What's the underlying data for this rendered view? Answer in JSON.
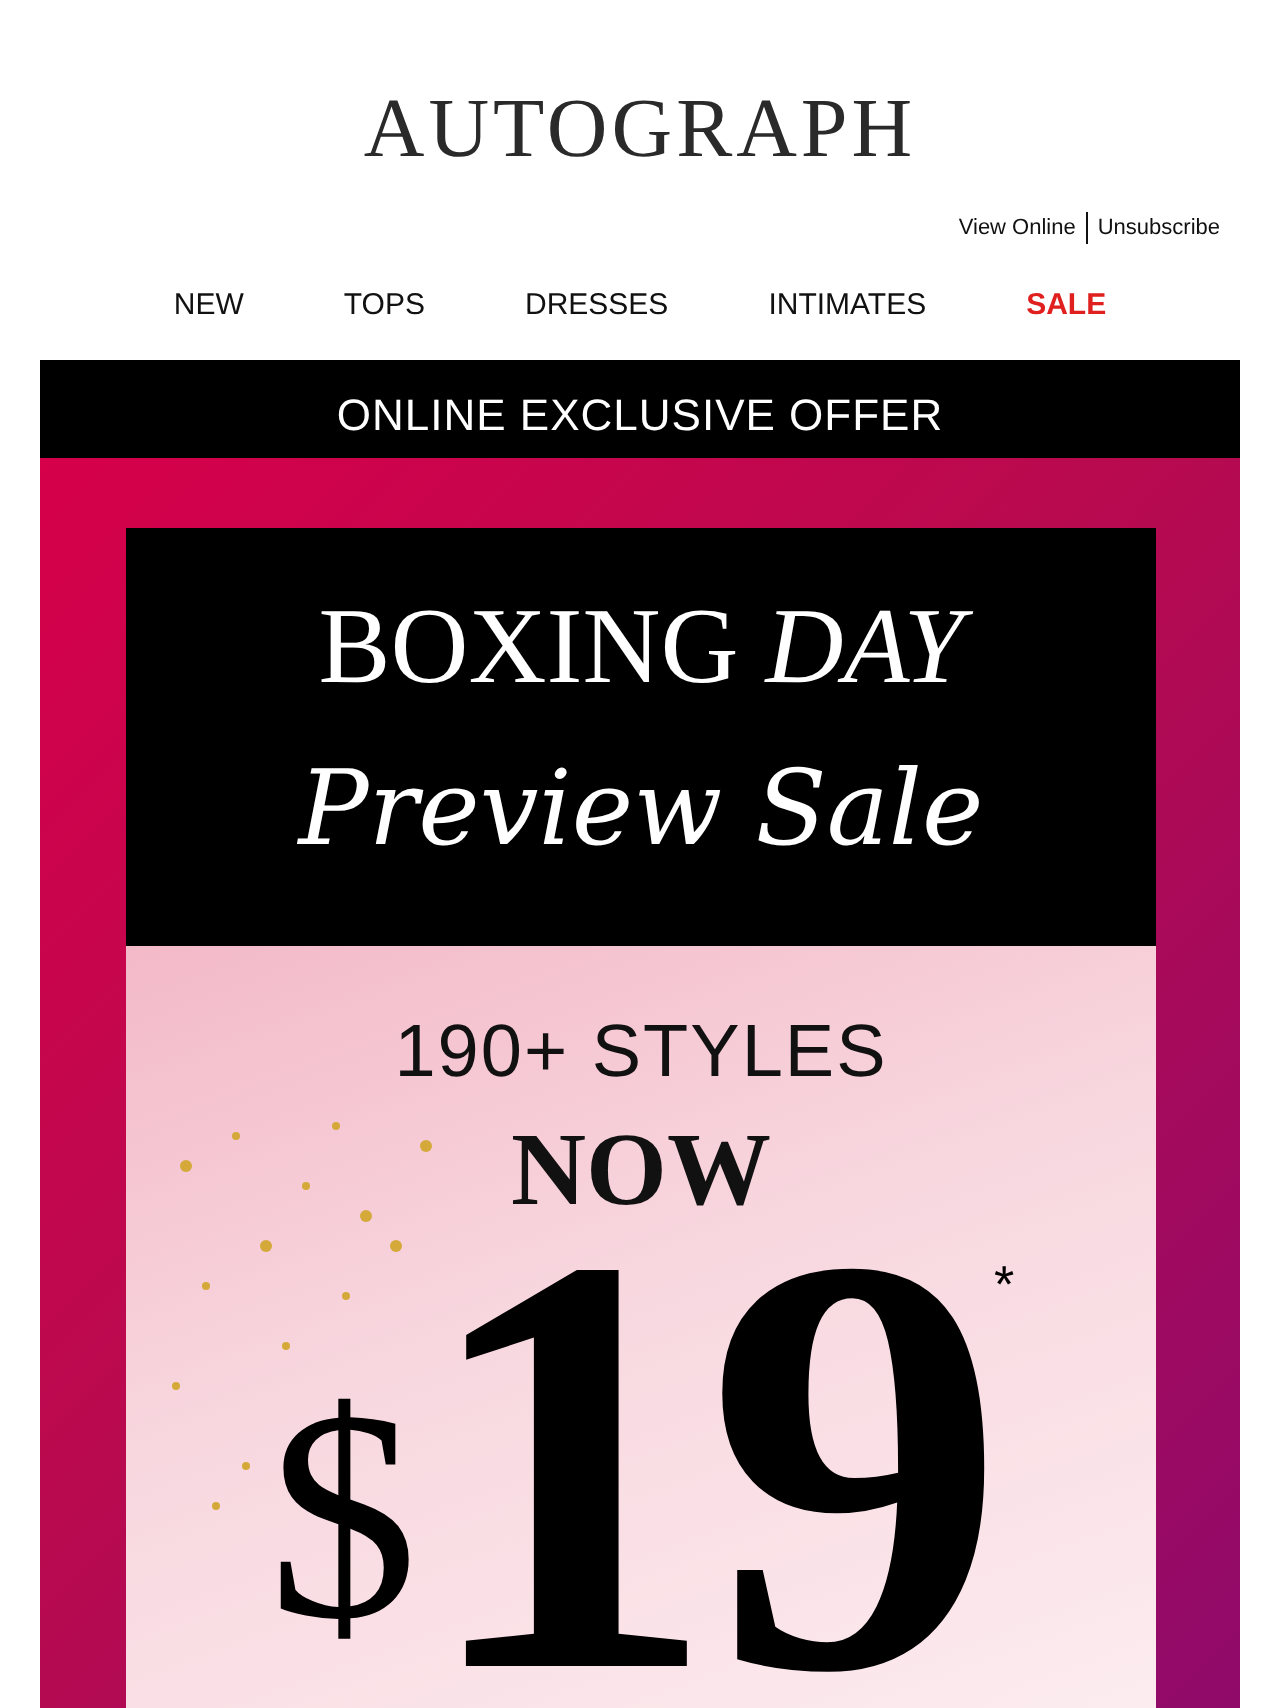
{
  "logo": "AUTOGRAPH",
  "header_links": [
    "View Online",
    "Unsubscribe"
  ],
  "nav": [
    {
      "label": "NEW",
      "kind": "normal"
    },
    {
      "label": "TOPS",
      "kind": "normal"
    },
    {
      "label": "DRESSES",
      "kind": "normal"
    },
    {
      "label": "INTIMATES",
      "kind": "normal"
    },
    {
      "label": "SALE",
      "kind": "sale"
    }
  ],
  "offer_bar": "ONLINE EXCLUSIVE OFFER",
  "banner": {
    "headline": "BOXING",
    "headline_italic": "DAY",
    "script": "Preview Sale",
    "styles": "190+ STYLES",
    "now": "NOW",
    "currency": "$",
    "price": "19",
    "footnote_mark": "*"
  }
}
